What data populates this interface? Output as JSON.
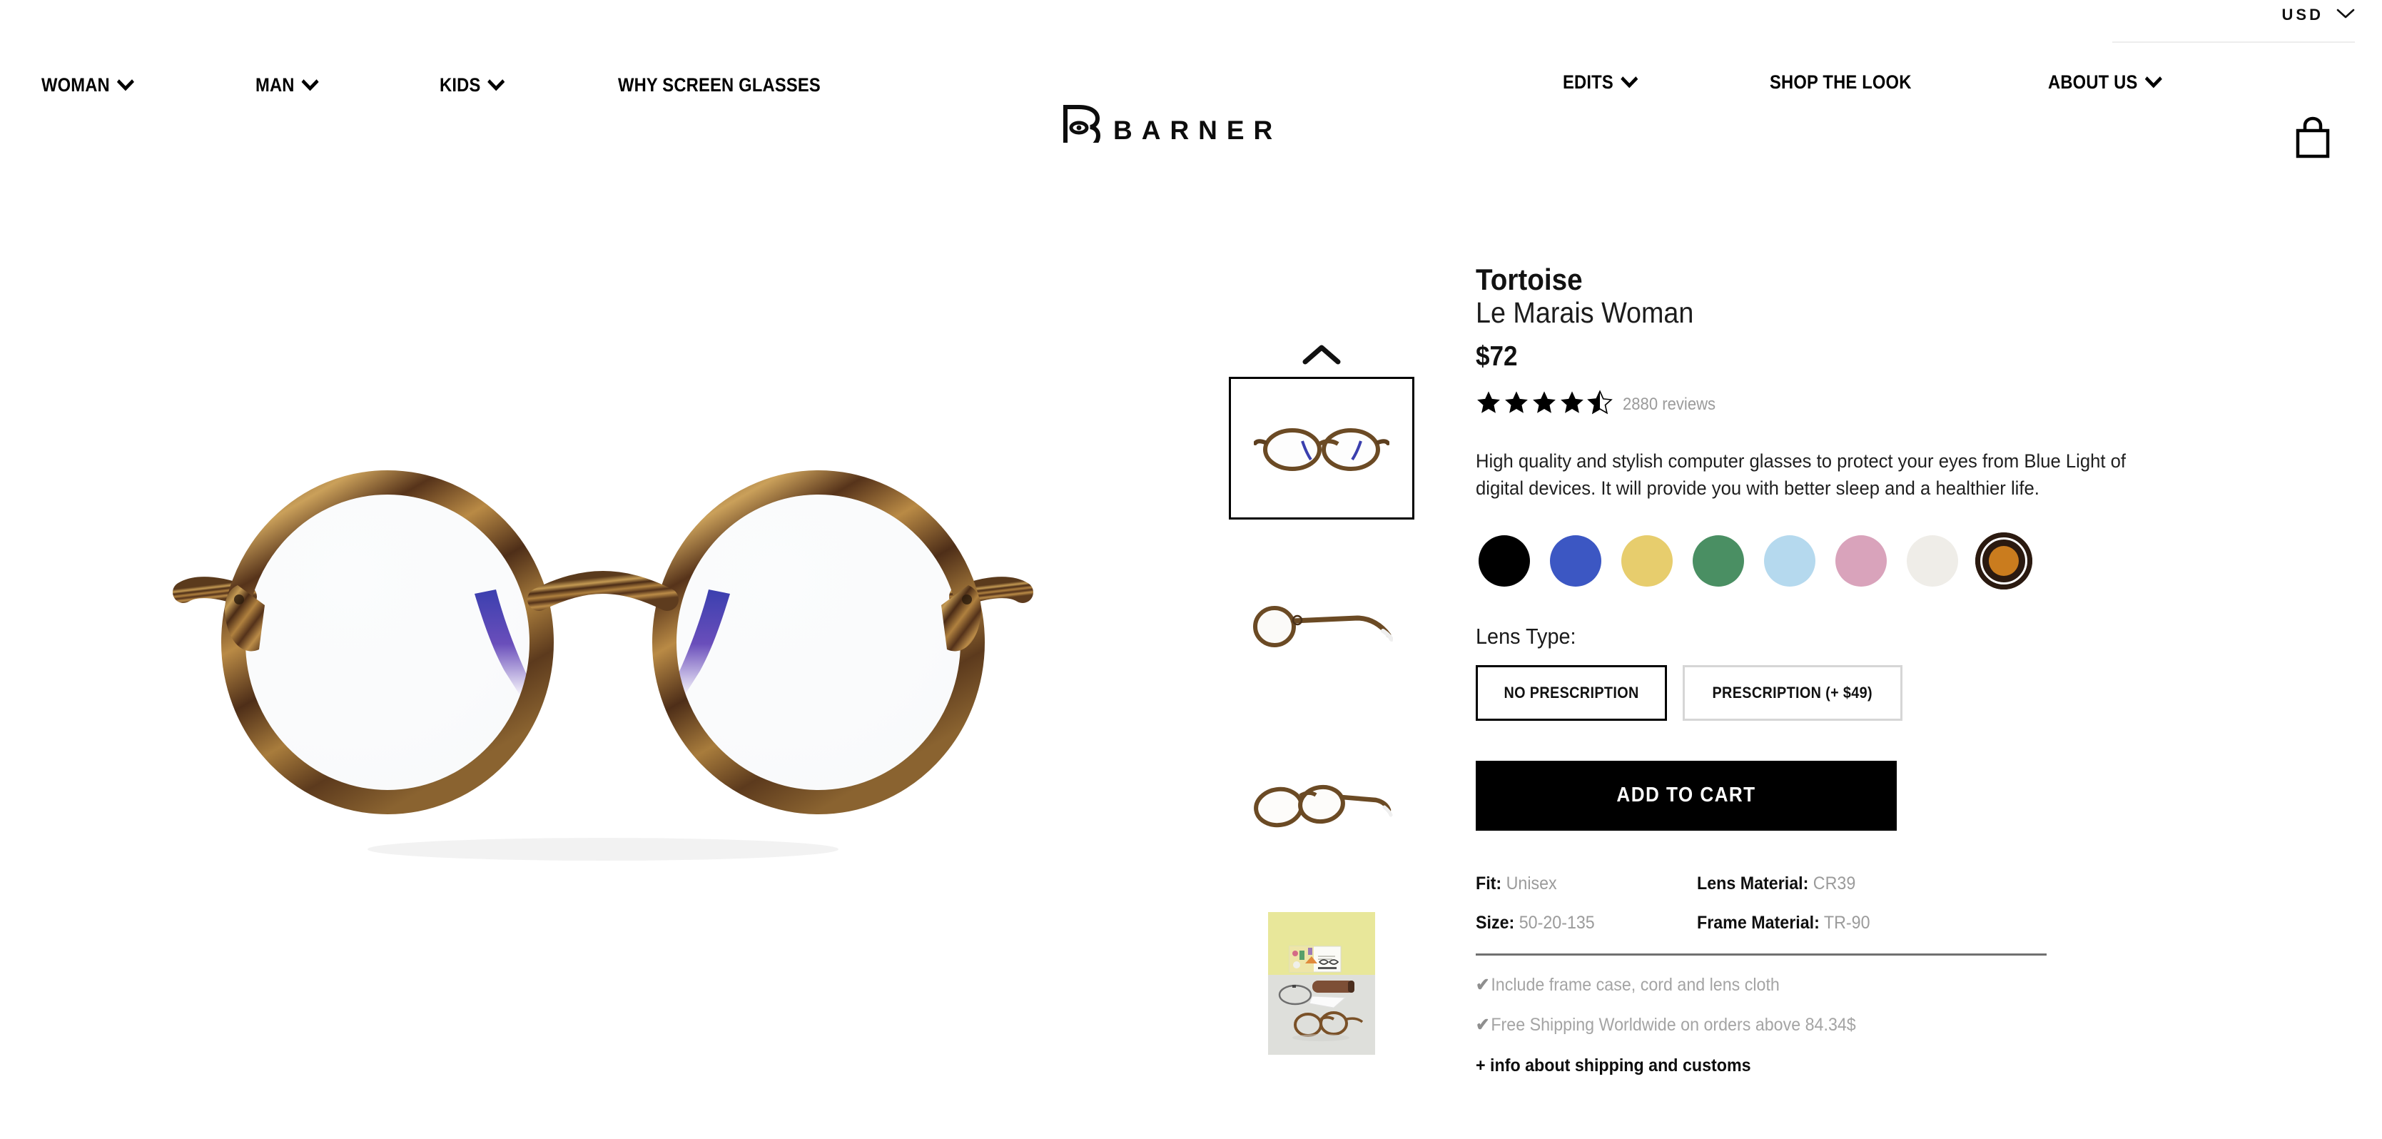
{
  "topbar": {
    "currency": "USD",
    "currency_icon": "chevron-down-icon"
  },
  "header": {
    "brand": "BARNER",
    "brand_mark_icon": "barner-b-monogram-icon",
    "cart_icon": "shopping-bag-icon",
    "nav_left": [
      {
        "label": "WOMAN",
        "icon": "chevron-down-icon",
        "has_dropdown": true
      },
      {
        "label": "MAN",
        "icon": "chevron-down-icon",
        "has_dropdown": true
      },
      {
        "label": "KIDS",
        "icon": "chevron-down-icon",
        "has_dropdown": true
      },
      {
        "label": "WHY SCREEN GLASSES",
        "icon": "",
        "has_dropdown": false
      }
    ],
    "nav_right": [
      {
        "label": "EDITS",
        "icon": "chevron-down-icon",
        "has_dropdown": true
      },
      {
        "label": "SHOP THE LOOK",
        "icon": "",
        "has_dropdown": false
      },
      {
        "label": "ABOUT US",
        "icon": "chevron-down-icon",
        "has_dropdown": true
      }
    ]
  },
  "gallery": {
    "scroll_up_icon": "chevron-up-icon",
    "thumbnails": [
      {
        "name": "front-view",
        "selected": true
      },
      {
        "name": "side-view",
        "selected": false
      },
      {
        "name": "three-quarter-view",
        "selected": false
      },
      {
        "name": "lifestyle-kit-photo",
        "selected": false
      }
    ]
  },
  "product": {
    "color_name": "Tortoise",
    "model_name": "Le Marais Woman",
    "price": "$72",
    "rating": 4.5,
    "reviews_count": "2880",
    "reviews_label": "reviews",
    "description": "High quality and stylish computer glasses to protect your eyes from Blue Light of digital devices. It will provide you with better sleep and a healthier life.",
    "colors": [
      {
        "name": "black",
        "hex": "#000000",
        "selected": false
      },
      {
        "name": "blue",
        "hex": "#3c57c3",
        "selected": false
      },
      {
        "name": "yellow",
        "hex": "#e7cd6d",
        "selected": false
      },
      {
        "name": "green",
        "hex": "#4a8f63",
        "selected": false
      },
      {
        "name": "light-blue",
        "hex": "#b5d9ee",
        "selected": false
      },
      {
        "name": "pink",
        "hex": "#d9a3bb",
        "selected": false
      },
      {
        "name": "cream",
        "hex": "#efede8",
        "selected": false
      },
      {
        "name": "tortoise",
        "hex": "#ca7c1e",
        "selected": true
      }
    ],
    "lens_type": {
      "label": "Lens Type:",
      "options": [
        {
          "label": "NO PRESCRIPTION",
          "selected": true
        },
        {
          "label": "PRESCRIPTION (+ $49)",
          "selected": false
        }
      ]
    },
    "add_to_cart_label": "ADD TO CART",
    "specs": [
      {
        "key": "Fit:",
        "value": "Unisex"
      },
      {
        "key": "Lens Material:",
        "value": "CR39"
      },
      {
        "key": "Size:",
        "value": "50-20-135"
      },
      {
        "key": "Frame Material:",
        "value": "TR-90"
      }
    ],
    "perks": [
      {
        "icon": "check-icon",
        "text": "Include frame case, cord and lens cloth"
      },
      {
        "icon": "check-icon",
        "text": "Free Shipping Worldwide on orders above 84.34$"
      }
    ],
    "shipping_link": "+ info about shipping and customs"
  }
}
